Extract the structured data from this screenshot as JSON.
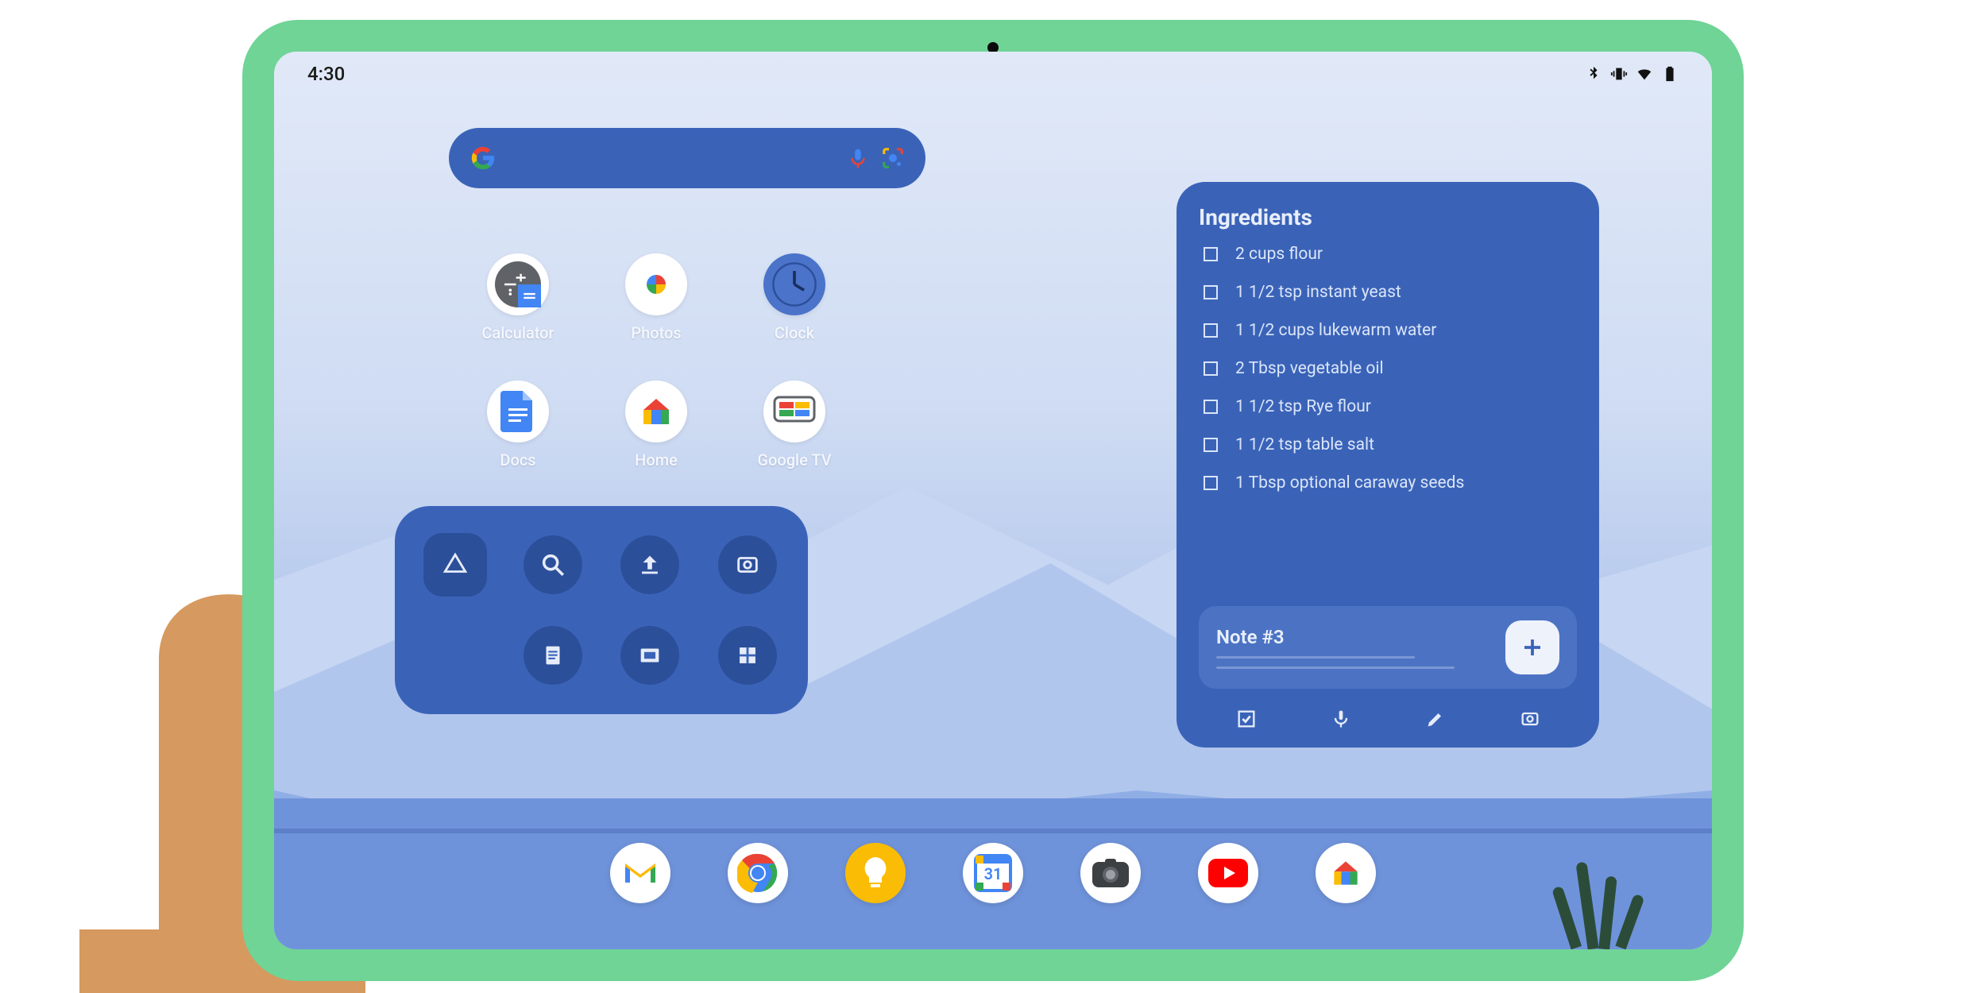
{
  "status": {
    "time": "4:30",
    "icons": [
      "bluetooth",
      "vibrate",
      "wifi",
      "battery"
    ]
  },
  "search": {
    "placeholder": ""
  },
  "apps": [
    {
      "id": "calculator",
      "label": "Calculator"
    },
    {
      "id": "photos",
      "label": "Photos"
    },
    {
      "id": "clock",
      "label": "Clock"
    },
    {
      "id": "docs",
      "label": "Docs"
    },
    {
      "id": "home",
      "label": "Home"
    },
    {
      "id": "google-tv",
      "label": "Google TV"
    }
  ],
  "drive_actions": [
    "drive",
    "search",
    "upload",
    "scan",
    "doc",
    "slides",
    "sheets"
  ],
  "keep": {
    "title": "Ingredients",
    "items": [
      "2 cups flour",
      "1 1/2 tsp instant yeast",
      "1 1/2 cups lukewarm water",
      "2 Tbsp vegetable oil",
      "1 1/2 tsp Rye flour",
      "1 1/2 tsp table salt",
      "1 Tbsp optional caraway seeds"
    ],
    "note_title": "Note  #3",
    "tools": [
      "checklist",
      "voice",
      "draw",
      "image"
    ]
  },
  "dock": [
    "gmail",
    "chrome",
    "keep",
    "calendar",
    "camera",
    "youtube",
    "home"
  ],
  "calendar_day": "31"
}
